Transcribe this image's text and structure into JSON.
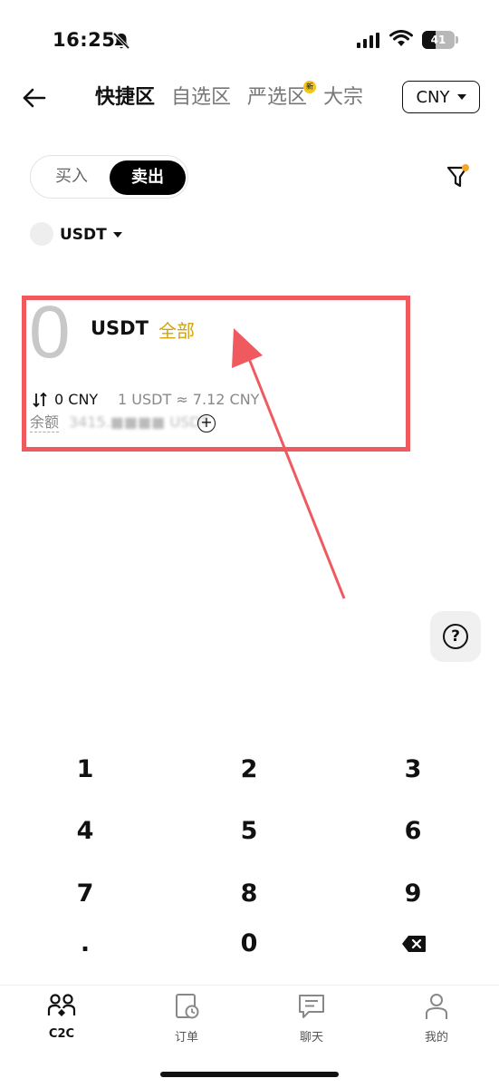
{
  "status_bar": {
    "time": "16:25",
    "battery": "41"
  },
  "header": {
    "tabs": [
      {
        "label": "快捷区",
        "active": true
      },
      {
        "label": "自选区",
        "active": false
      },
      {
        "label": "严选区",
        "active": false,
        "badge": "新"
      },
      {
        "label": "大宗",
        "active": false
      }
    ],
    "currency": "CNY"
  },
  "toggle": {
    "buy_label": "买入",
    "sell_label": "卖出",
    "selected": "卖出"
  },
  "coin_selector": {
    "selected": "USDT"
  },
  "amount": {
    "value": "0",
    "unit": "USDT",
    "all_label": "全部",
    "converted": "0 CNY",
    "rate": "1 USDT ≈ 7.12 CNY",
    "balance_label": "余额",
    "balance_value": "3415.■■■■ USDT"
  },
  "keypad": {
    "keys": [
      "1",
      "2",
      "3",
      "4",
      "5",
      "6",
      "7",
      "8",
      "9",
      ".",
      "0"
    ]
  },
  "bottom_nav": [
    {
      "label": "C2C",
      "icon": "users-icon",
      "active": true
    },
    {
      "label": "订单",
      "icon": "order-clock-icon",
      "active": false
    },
    {
      "label": "聊天",
      "icon": "chat-icon",
      "active": false
    },
    {
      "label": "我的",
      "icon": "person-icon",
      "active": false
    }
  ],
  "colors": {
    "accent": "#d4a30a",
    "annotation": "#ef5a5f",
    "primary": "#000000"
  }
}
